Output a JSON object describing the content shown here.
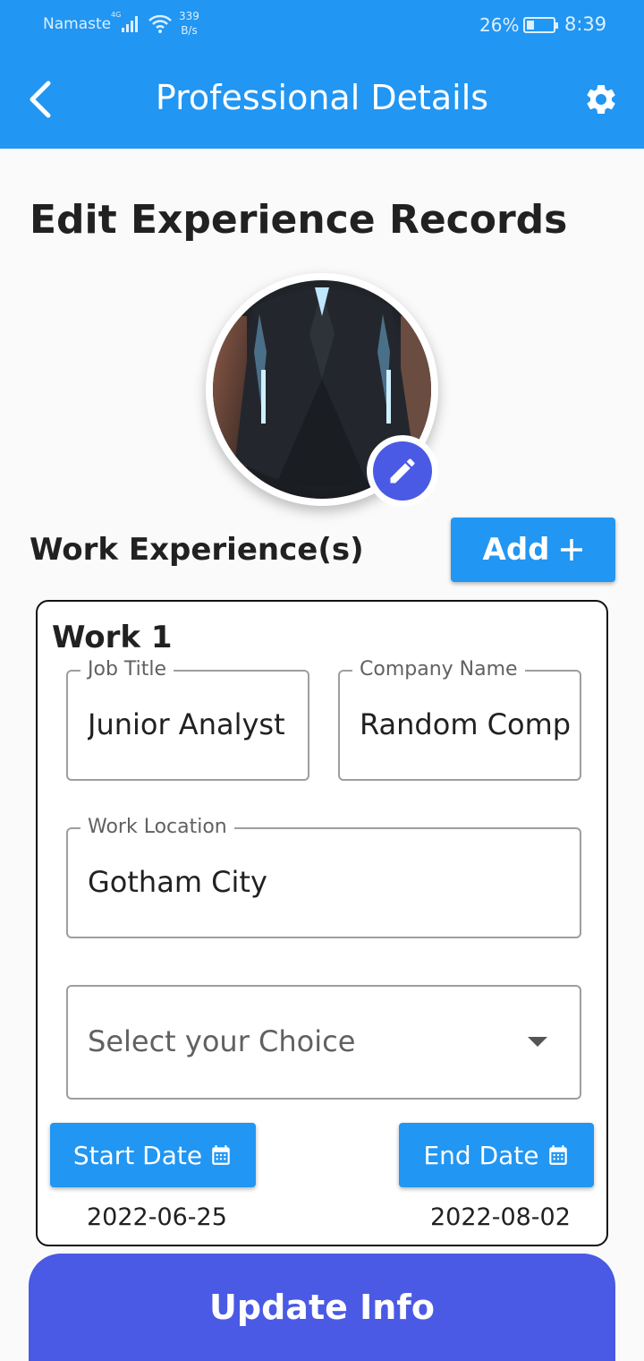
{
  "status_bar": {
    "carrier": "Namaste",
    "network_type": "4G",
    "speed_value": "339",
    "speed_unit": "B/s",
    "battery_percent": "26%",
    "battery_level": 0.26,
    "time": "8:39"
  },
  "app_bar": {
    "title": "Professional Details",
    "back_icon": "back-arrow-icon",
    "settings_icon": "gear-icon"
  },
  "page": {
    "title": "Edit Experience Records"
  },
  "avatar": {
    "edit_icon": "pencil-icon"
  },
  "work_section": {
    "label": "Work Experience(s)",
    "add_label": "Add"
  },
  "work_card": {
    "title": "Work 1",
    "job_title": {
      "label": "Job Title",
      "value": "Junior Analyst"
    },
    "company_name": {
      "label": "Company Name",
      "value": "Random Comp"
    },
    "work_location": {
      "label": "Work Location",
      "value": "Gotham City"
    },
    "choice": {
      "placeholder": "Select your Choice"
    },
    "start_date": {
      "label": "Start Date",
      "value": "2022-06-25"
    },
    "end_date": {
      "label": "End Date",
      "value": "2022-08-02"
    }
  },
  "update_label": "Update Info",
  "colors": {
    "primary": "#2196f3",
    "accent": "#4a5ae4"
  }
}
